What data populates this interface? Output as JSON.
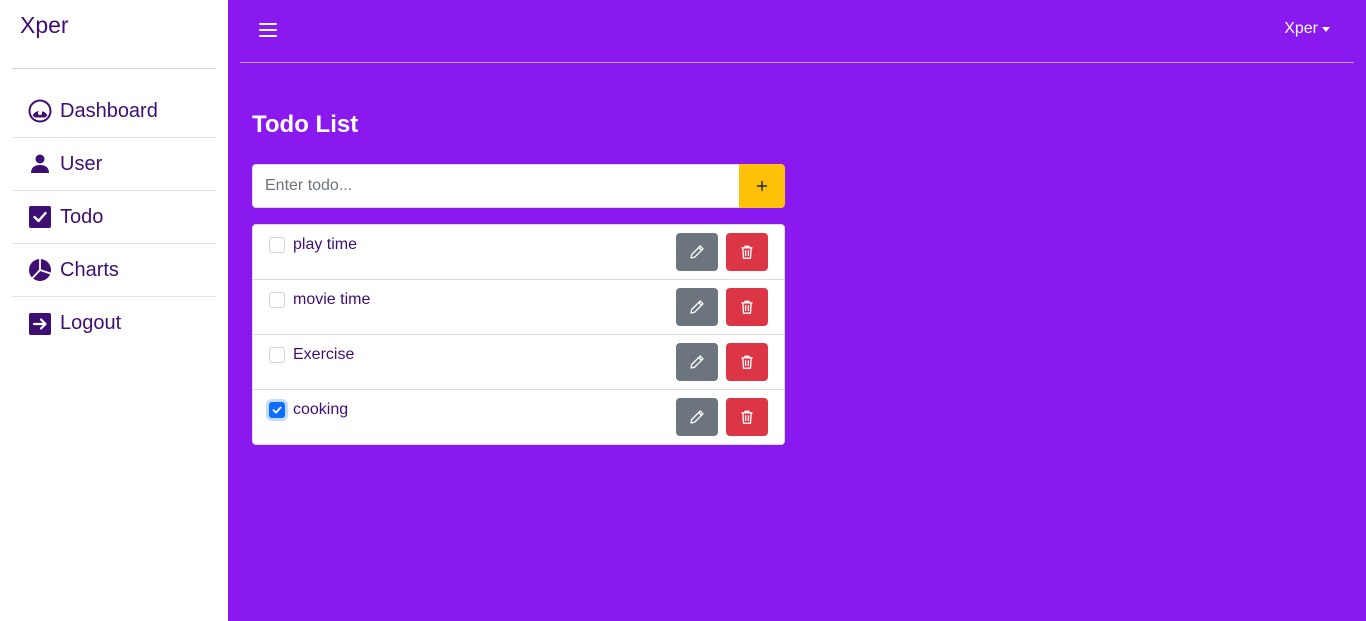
{
  "app": {
    "brand": "Xper"
  },
  "sidebar": {
    "items": [
      {
        "label": "Dashboard",
        "icon": "speedometer-icon"
      },
      {
        "label": "User",
        "icon": "user-icon"
      },
      {
        "label": "Todo",
        "icon": "check-square-icon"
      },
      {
        "label": "Charts",
        "icon": "pie-chart-icon"
      },
      {
        "label": "Logout",
        "icon": "logout-icon"
      }
    ]
  },
  "topbar": {
    "menu_icon": "hamburger-icon",
    "user_label": "Xper"
  },
  "main": {
    "title": "Todo List",
    "input": {
      "placeholder": "Enter todo...",
      "value": ""
    },
    "add_label": "+",
    "todos": [
      {
        "text": "play time",
        "checked": false
      },
      {
        "text": "movie time",
        "checked": false
      },
      {
        "text": "Exercise",
        "checked": false
      },
      {
        "text": "cooking",
        "checked": true
      }
    ]
  },
  "colors": {
    "background": "#8a19ef",
    "sidebar_text": "#3e0f72",
    "add_button": "#ffc107",
    "edit_button": "#6c757d",
    "delete_button": "#dc3545",
    "checkbox_checked": "#0d6efd"
  }
}
